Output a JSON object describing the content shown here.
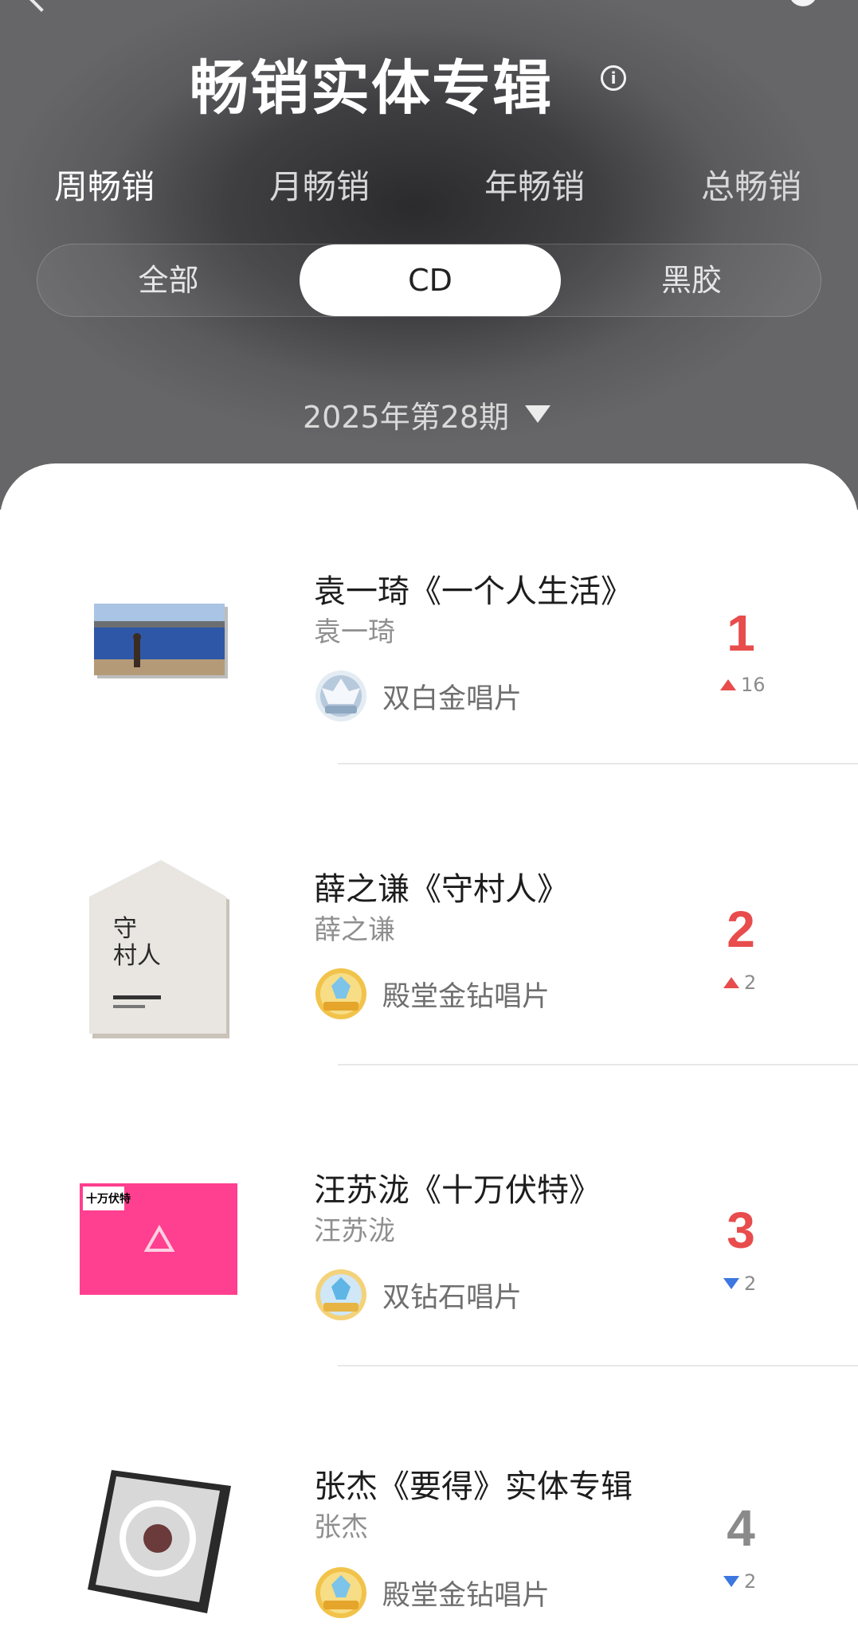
{
  "header": {
    "title": "畅销实体专辑",
    "info_icon": "info-icon",
    "period_tabs": [
      {
        "label": "周畅销",
        "active": true
      },
      {
        "label": "月畅销",
        "active": false
      },
      {
        "label": "年畅销",
        "active": false
      },
      {
        "label": "总畅销",
        "active": false
      }
    ],
    "format_tabs": [
      {
        "label": "全部",
        "active": false
      },
      {
        "label": "CD",
        "active": true
      },
      {
        "label": "黑胶",
        "active": false
      }
    ],
    "issue": "2025年第28期"
  },
  "colors": {
    "rank_red": "#e84c4c",
    "rank_gray": "#8a8a8a",
    "up_red": "#e84c4c",
    "down_blue": "#3d77e0"
  },
  "albums": [
    {
      "rank": "1",
      "title": "袁一琦《一个人生活》",
      "artist": "袁一琦",
      "badge": "双白金唱片",
      "badge_icon": "platinum-medal-icon",
      "change": "16",
      "direction": "up"
    },
    {
      "rank": "2",
      "title": "薛之谦《守村人》",
      "artist": "薛之谦",
      "badge": "殿堂金钻唱片",
      "badge_icon": "gold-diamond-medal-icon",
      "change": "2",
      "direction": "up"
    },
    {
      "rank": "3",
      "title": "汪苏泷《十万伏特》",
      "artist": "汪苏泷",
      "badge": "双钻石唱片",
      "badge_icon": "diamond-medal-icon",
      "change": "2",
      "direction": "down"
    },
    {
      "rank": "4",
      "title": "张杰《要得》实体专辑",
      "artist": "张杰",
      "badge": "殿堂金钻唱片",
      "badge_icon": "gold-diamond-medal-icon",
      "change": "2",
      "direction": "down"
    }
  ]
}
